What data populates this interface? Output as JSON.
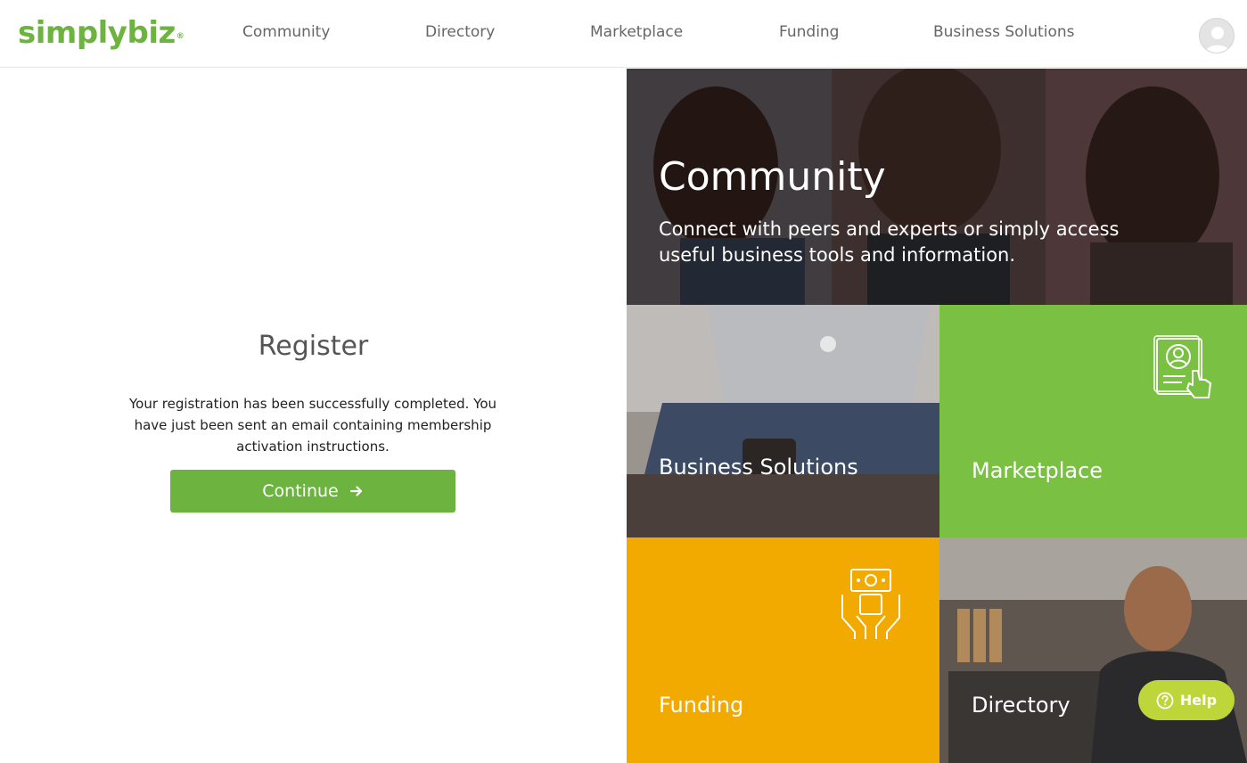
{
  "brand": {
    "logo_simply": "simply",
    "logo_biz": "biz",
    "logo_mark": "®",
    "accent": "#6cb33f"
  },
  "nav": {
    "items": [
      {
        "label": "Community"
      },
      {
        "label": "Directory"
      },
      {
        "label": "Marketplace"
      },
      {
        "label": "Funding"
      },
      {
        "label": "Business Solutions"
      }
    ]
  },
  "register": {
    "title": "Register",
    "message": "Your registration has been successfully completed. You have just been sent an email containing membership activation instructions.",
    "continue_label": "Continue"
  },
  "tiles": {
    "community": {
      "title": "Community",
      "subtitle": "Connect with peers and experts or simply access useful business tools and information."
    },
    "business_solutions": {
      "label": "Business Solutions"
    },
    "marketplace": {
      "label": "Marketplace",
      "icon": "profile-touch-icon",
      "color": "#7ac143"
    },
    "funding": {
      "label": "Funding",
      "icon": "money-hands-icon",
      "color": "#f2a900"
    },
    "directory": {
      "label": "Directory"
    }
  },
  "help": {
    "label": "Help",
    "color": "#bed63a"
  }
}
